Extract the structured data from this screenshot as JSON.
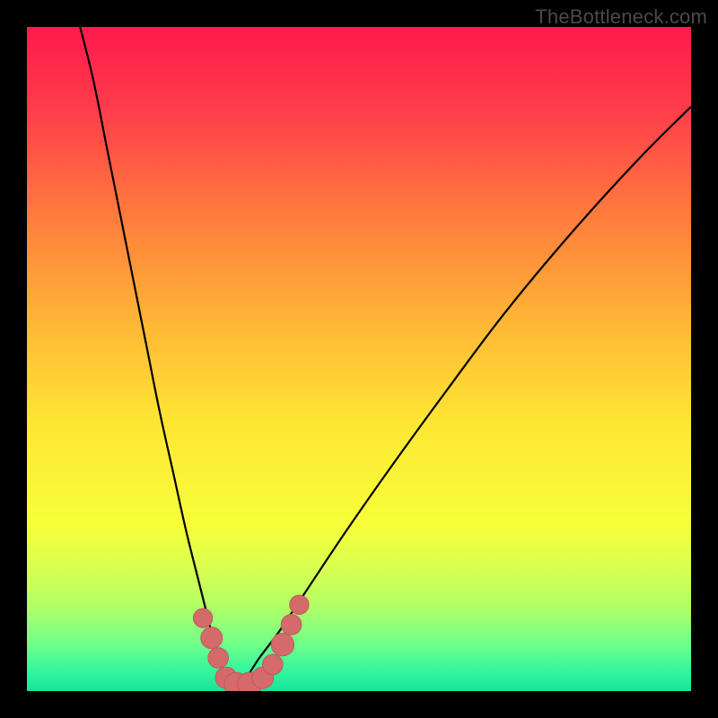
{
  "watermark": "TheBottleneck.com",
  "colors": {
    "frame": "#000000",
    "watermark_text": "#4a4a4a",
    "curve_stroke": "#000000",
    "marker_fill": "#d46a6a",
    "marker_stroke": "#c25a5a",
    "gradient_stops": [
      {
        "offset": 0.0,
        "color": "#ff1a4d"
      },
      {
        "offset": 0.12,
        "color": "#ff3b4a"
      },
      {
        "offset": 0.28,
        "color": "#ff7a3d"
      },
      {
        "offset": 0.45,
        "color": "#ffb836"
      },
      {
        "offset": 0.6,
        "color": "#ffe734"
      },
      {
        "offset": 0.75,
        "color": "#f6ff3a"
      },
      {
        "offset": 0.82,
        "color": "#d6ff52"
      },
      {
        "offset": 0.88,
        "color": "#a9ff6a"
      },
      {
        "offset": 0.93,
        "color": "#6fff8a"
      },
      {
        "offset": 0.97,
        "color": "#34f59e"
      },
      {
        "offset": 1.0,
        "color": "#14e59a"
      }
    ]
  },
  "chart_data": {
    "type": "line",
    "title": "",
    "xlabel": "",
    "ylabel": "",
    "xlim": [
      0,
      100
    ],
    "ylim": [
      0,
      100
    ],
    "note": "Bottleneck-style curve: y ≈ percentage bottleneck (100 top, 0 bottom); minimum near x≈31; left branch steep, right branch shallow.",
    "series": [
      {
        "name": "left-branch",
        "x": [
          8,
          10,
          12,
          14,
          16,
          18,
          20,
          22,
          24,
          26,
          27,
          28,
          29,
          30,
          31
        ],
        "y": [
          100,
          92,
          82,
          72,
          62,
          52,
          42,
          33,
          24,
          16,
          12,
          8,
          5,
          2,
          0
        ]
      },
      {
        "name": "right-branch",
        "x": [
          31,
          33,
          35,
          38,
          42,
          48,
          55,
          63,
          72,
          82,
          92,
          100
        ],
        "y": [
          0,
          2,
          5,
          9,
          15,
          24,
          34,
          45,
          57,
          69,
          80,
          88
        ]
      }
    ],
    "markers": {
      "name": "highlighted-points",
      "points": [
        {
          "x": 26.5,
          "y": 11,
          "r": 1.0
        },
        {
          "x": 27.8,
          "y": 8,
          "r": 1.2
        },
        {
          "x": 28.8,
          "y": 5,
          "r": 1.1
        },
        {
          "x": 30.0,
          "y": 2,
          "r": 1.2
        },
        {
          "x": 31.5,
          "y": 1,
          "r": 1.4
        },
        {
          "x": 33.5,
          "y": 1,
          "r": 1.4
        },
        {
          "x": 35.5,
          "y": 2,
          "r": 1.2
        },
        {
          "x": 37.0,
          "y": 4,
          "r": 1.1
        },
        {
          "x": 38.5,
          "y": 7,
          "r": 1.3
        },
        {
          "x": 39.8,
          "y": 10,
          "r": 1.1
        },
        {
          "x": 41.0,
          "y": 13,
          "r": 1.0
        }
      ]
    }
  }
}
